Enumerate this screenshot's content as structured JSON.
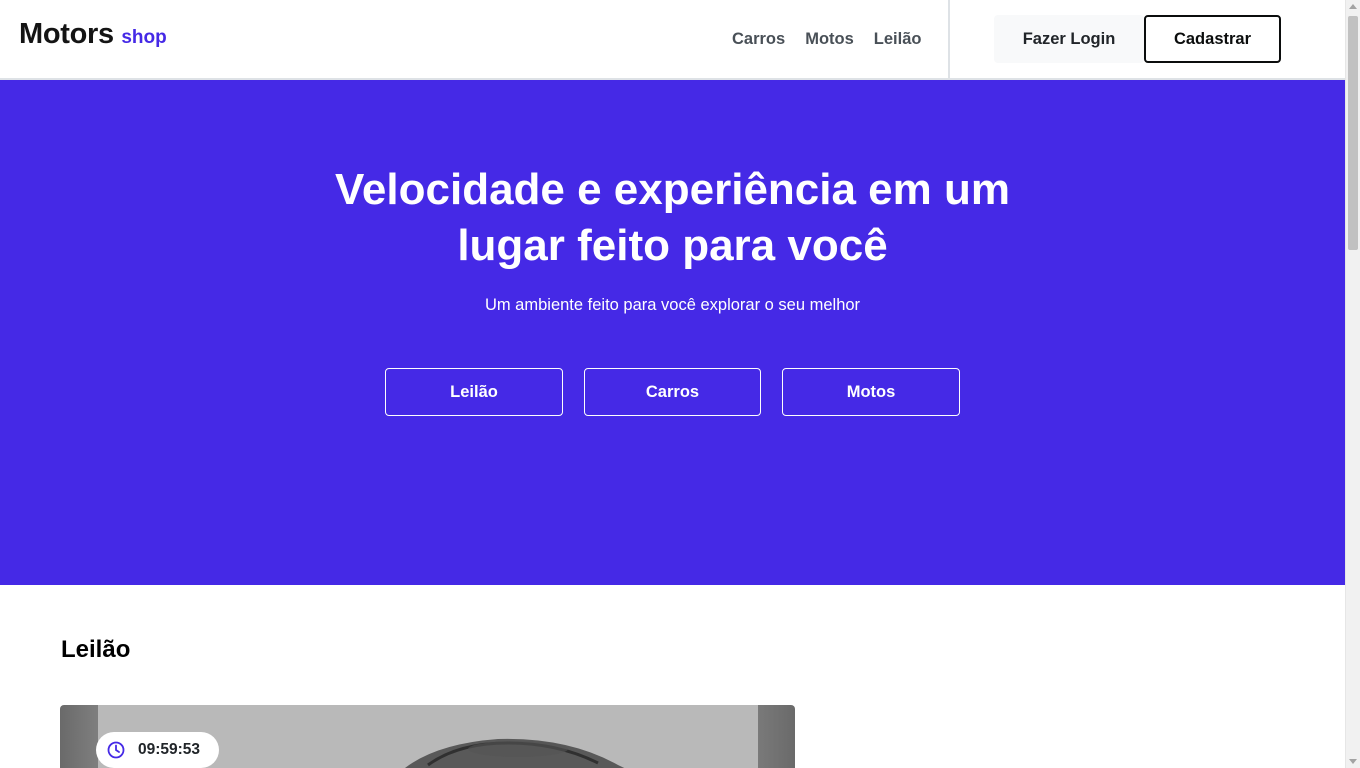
{
  "header": {
    "logo": {
      "main": "Motors",
      "sub": "shop"
    },
    "nav": [
      {
        "label": "Carros"
      },
      {
        "label": "Motos"
      },
      {
        "label": "Leilão"
      }
    ],
    "login_label": "Fazer Login",
    "signup_label": "Cadastrar"
  },
  "hero": {
    "title_line1": "Velocidade e experiência em um",
    "title_line2": "lugar feito para você",
    "subtitle": "Um ambiente feito para você explorar o seu melhor",
    "buttons": [
      {
        "label": "Leilão"
      },
      {
        "label": "Carros"
      },
      {
        "label": "Motos"
      }
    ]
  },
  "auction": {
    "section_title": "Leilão",
    "card": {
      "timer": "09:59:53",
      "image_icon": "car-photo"
    }
  },
  "icons": {
    "timer": "clock-icon"
  },
  "colors": {
    "brand": "#4529e6",
    "text_dark": "#141414",
    "nav_text": "#495057",
    "hero_bg": "#4529e6",
    "divider": "#dee2e6"
  }
}
